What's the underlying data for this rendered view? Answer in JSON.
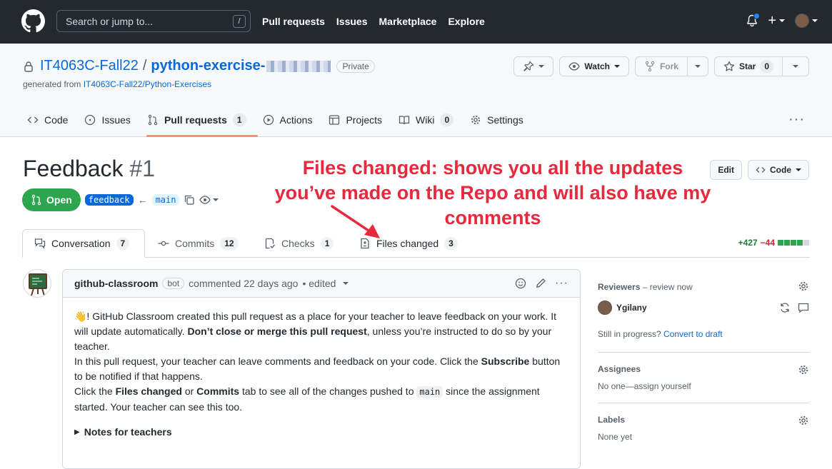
{
  "topbar": {
    "search_placeholder": "Search or jump to...",
    "search_shortcut": "/",
    "nav": [
      "Pull requests",
      "Issues",
      "Marketplace",
      "Explore"
    ]
  },
  "repo": {
    "owner": "IT4063C-Fall22",
    "separator": "/",
    "name": "python-exercise-",
    "visibility": "Private",
    "generated_prefix": "generated from ",
    "generated_link": "IT4063C-Fall22/Python-Exercises",
    "watch_label": "Watch",
    "fork_label": "Fork",
    "star_label": "Star",
    "star_count": "0"
  },
  "repo_tabs": [
    {
      "label": "Code",
      "count": ""
    },
    {
      "label": "Issues",
      "count": ""
    },
    {
      "label": "Pull requests",
      "count": "1"
    },
    {
      "label": "Actions",
      "count": ""
    },
    {
      "label": "Projects",
      "count": ""
    },
    {
      "label": "Wiki",
      "count": "0"
    },
    {
      "label": "Settings",
      "count": ""
    }
  ],
  "pr": {
    "title": "Feedback",
    "number": "#1",
    "edit_label": "Edit",
    "code_label": "Code",
    "state": "Open",
    "head_branch": "feedback",
    "base_branch": "main"
  },
  "annotation": {
    "lines": [
      "Files changed: shows you all the updates",
      "you’ve made on the Repo and will also have my",
      "comments"
    ]
  },
  "pr_tabs": [
    {
      "label": "Conversation",
      "count": "7"
    },
    {
      "label": "Commits",
      "count": "12"
    },
    {
      "label": "Checks",
      "count": "1"
    },
    {
      "label": "Files changed",
      "count": "3"
    }
  ],
  "diffstat": {
    "additions": "+427",
    "deletions": "−44"
  },
  "comment": {
    "author": "github-classroom",
    "badge": "bot",
    "meta": "commented 22 days ago",
    "edited": "• edited",
    "p1_a": "👋! GitHub Classroom created this pull request as a place for your teacher to leave feedback on your work. It will update automatically. ",
    "p1_b": "Don’t close or merge this pull request",
    "p1_c": ", unless you’re instructed to do so by your teacher.",
    "p2_a": "In this pull request, your teacher can leave comments and feedback on your code. Click the ",
    "p2_b": "Subscribe",
    "p2_c": " button to be notified if that happens.",
    "p3_a": "Click the ",
    "p3_b": "Files changed",
    "p3_c": " or ",
    "p3_d": "Commits",
    "p3_e": " tab to see all of the changes pushed to ",
    "p3_code": "main",
    "p3_f": " since the assignment started. Your teacher can see this too.",
    "notes": "Notes for teachers"
  },
  "sidebar": {
    "reviewers_title": "Reviewers",
    "reviewers_suffix": " – review now",
    "reviewer_name": "Ygilany",
    "progress_text": "Still in progress? ",
    "progress_link": "Convert to draft",
    "assignees_title": "Assignees",
    "assignees_text": "No one—",
    "assignees_link": "assign yourself",
    "labels_title": "Labels",
    "labels_text": "None yet"
  },
  "colors": {
    "accent": "#0969da",
    "open": "#2da44e",
    "annotation": "#e8283d",
    "header": "#24292f"
  }
}
